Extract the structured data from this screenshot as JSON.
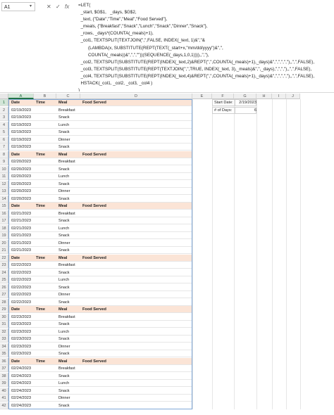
{
  "namebox": "A1",
  "formula_icons": [
    "cancel-icon",
    "confirm-icon",
    "fx-icon"
  ],
  "formula_text": "=LET(\n  _start, $G$1,   _days, $G$2,\n  _text, {\"Date\",\"Time\",\"Meal\",\"Food Served\"},\n  _meals, {\"Breakfast\",\"Snack\",\"Lunch\",\"Snack\",\"Dinner\",\"Snack\"},\n  _rows, _days*(COUNTA(_meals)+1),\n  _col1, TEXTSPLIT(TEXTJOIN(\",\",FALSE, INDEX(_text, 1)&\",\"&\n        (LAMBDA(x, SUBSTITUTE(REPT(TEXT(_start+x,\"mm/dd/yyyy\")&\",\",\n        COUNTA(_meals))&\",\",\",\"\"))(SEQUENCE(_days,1,0,1)))),,\",\"),\n  _col2, TEXTSPLIT(SUBSTITUTE(REPT(INDEX(_text,2)&REPT(\",\",COUNTA(_meals)+1),_days)&\",\",\",\",\",\"),,\",\",FALSE),\n  _col3, TEXTSPLIT(SUBSTITUTE(REPT(TEXTJOIN(\",\",TRUE, INDEX(_text, 3),_meals)&\",\",_days),\",\",\",\"),,\",\",FALSE),\n  _col4, TEXTSPLIT(SUBSTITUTE(REPT(INDEX(_text,4)&REPT(\",\",COUNTA(_meals)+1),_days)&\",\",\",\",\",\"),,\",\",FALSE),\n  HSTACK(_col1, _col2, _col3, _col4 )\n)",
  "columns": [
    "A",
    "B",
    "C",
    "D",
    "E",
    "F",
    "G",
    "H",
    "I",
    "J"
  ],
  "selected_column": "A",
  "selected_row": 1,
  "side_cells": [
    {
      "label": "Start Date:",
      "value": "2/19/2023"
    },
    {
      "label": "# of Days:",
      "value": "6"
    }
  ],
  "rows": [
    {
      "n": "1",
      "header": true,
      "date": "Date",
      "time": "Time",
      "meal": "Meal",
      "food": "Food Served"
    },
    {
      "n": "2",
      "date": "02/19/2023",
      "time": "",
      "meal": "Breakfast",
      "food": ""
    },
    {
      "n": "3",
      "date": "02/19/2023",
      "time": "",
      "meal": "Snack",
      "food": ""
    },
    {
      "n": "4",
      "date": "02/19/2023",
      "time": "",
      "meal": "Lunch",
      "food": ""
    },
    {
      "n": "5",
      "date": "02/19/2023",
      "time": "",
      "meal": "Snack",
      "food": ""
    },
    {
      "n": "6",
      "date": "02/19/2023",
      "time": "",
      "meal": "Dinner",
      "food": ""
    },
    {
      "n": "7",
      "date": "02/19/2023",
      "time": "",
      "meal": "Snack",
      "food": ""
    },
    {
      "n": "8",
      "header": true,
      "date": "Date",
      "time": "Time",
      "meal": "Meal",
      "food": "Food Served"
    },
    {
      "n": "9",
      "date": "02/20/2023",
      "time": "",
      "meal": "Breakfast",
      "food": ""
    },
    {
      "n": "10",
      "date": "02/20/2023",
      "time": "",
      "meal": "Snack",
      "food": ""
    },
    {
      "n": "11",
      "date": "02/20/2023",
      "time": "",
      "meal": "Lunch",
      "food": ""
    },
    {
      "n": "12",
      "date": "02/20/2023",
      "time": "",
      "meal": "Snack",
      "food": ""
    },
    {
      "n": "13",
      "date": "02/20/2023",
      "time": "",
      "meal": "Dinner",
      "food": ""
    },
    {
      "n": "14",
      "date": "02/20/2023",
      "time": "",
      "meal": "Snack",
      "food": ""
    },
    {
      "n": "15",
      "header": true,
      "date": "Date",
      "time": "Time",
      "meal": "Meal",
      "food": "Food Served"
    },
    {
      "n": "16",
      "date": "02/21/2023",
      "time": "",
      "meal": "Breakfast",
      "food": ""
    },
    {
      "n": "17",
      "date": "02/21/2023",
      "time": "",
      "meal": "Snack",
      "food": ""
    },
    {
      "n": "18",
      "date": "02/21/2023",
      "time": "",
      "meal": "Lunch",
      "food": ""
    },
    {
      "n": "19",
      "date": "02/21/2023",
      "time": "",
      "meal": "Snack",
      "food": ""
    },
    {
      "n": "20",
      "date": "02/21/2023",
      "time": "",
      "meal": "Dinner",
      "food": ""
    },
    {
      "n": "21",
      "date": "02/21/2023",
      "time": "",
      "meal": "Snack",
      "food": ""
    },
    {
      "n": "22",
      "header": true,
      "date": "Date",
      "time": "Time",
      "meal": "Meal",
      "food": "Food Served"
    },
    {
      "n": "23",
      "date": "02/22/2023",
      "time": "",
      "meal": "Breakfast",
      "food": ""
    },
    {
      "n": "24",
      "date": "02/22/2023",
      "time": "",
      "meal": "Snack",
      "food": ""
    },
    {
      "n": "25",
      "date": "02/22/2023",
      "time": "",
      "meal": "Lunch",
      "food": ""
    },
    {
      "n": "26",
      "date": "02/22/2023",
      "time": "",
      "meal": "Snack",
      "food": ""
    },
    {
      "n": "27",
      "date": "02/22/2023",
      "time": "",
      "meal": "Dinner",
      "food": ""
    },
    {
      "n": "28",
      "date": "02/22/2023",
      "time": "",
      "meal": "Snack",
      "food": ""
    },
    {
      "n": "29",
      "header": true,
      "date": "Date",
      "time": "Time",
      "meal": "Meal",
      "food": "Food Served"
    },
    {
      "n": "30",
      "date": "02/23/2023",
      "time": "",
      "meal": "Breakfast",
      "food": ""
    },
    {
      "n": "31",
      "date": "02/23/2023",
      "time": "",
      "meal": "Snack",
      "food": ""
    },
    {
      "n": "32",
      "date": "02/23/2023",
      "time": "",
      "meal": "Lunch",
      "food": ""
    },
    {
      "n": "33",
      "date": "02/23/2023",
      "time": "",
      "meal": "Snack",
      "food": ""
    },
    {
      "n": "34",
      "date": "02/23/2023",
      "time": "",
      "meal": "Dinner",
      "food": ""
    },
    {
      "n": "35",
      "date": "02/23/2023",
      "time": "",
      "meal": "Snack",
      "food": ""
    },
    {
      "n": "36",
      "header": true,
      "date": "Date",
      "time": "Time",
      "meal": "Meal",
      "food": "Food Served"
    },
    {
      "n": "37",
      "date": "02/24/2023",
      "time": "",
      "meal": "Breakfast",
      "food": ""
    },
    {
      "n": "38",
      "date": "02/24/2023",
      "time": "",
      "meal": "Snack",
      "food": ""
    },
    {
      "n": "39",
      "date": "02/24/2023",
      "time": "",
      "meal": "Lunch",
      "food": ""
    },
    {
      "n": "40",
      "date": "02/24/2023",
      "time": "",
      "meal": "Snack",
      "food": ""
    },
    {
      "n": "41",
      "date": "02/24/2023",
      "time": "",
      "meal": "Dinner",
      "food": ""
    },
    {
      "n": "42",
      "date": "02/24/2023",
      "time": "",
      "meal": "Snack",
      "food": ""
    }
  ],
  "colors": {
    "header_fill": "#fbe4d6",
    "selection_green": "#217346",
    "spill_border": "#7fa8d8"
  }
}
